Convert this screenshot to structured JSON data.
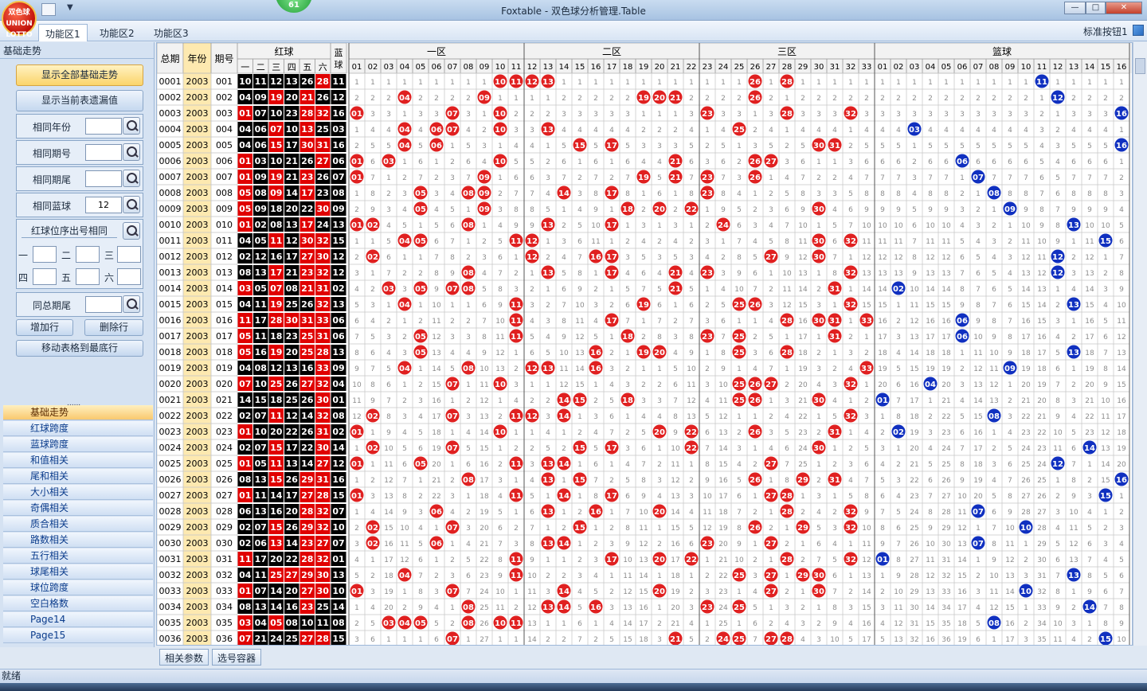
{
  "window": {
    "title": "Foxtable - 双色球分析管理.Table",
    "logo_text": "双色球 UNION LOTTO",
    "badge": "61"
  },
  "ribbon": {
    "tabs": [
      "功能区1",
      "功能区2",
      "功能区3"
    ],
    "active_tab": 0,
    "right_button": "标准按钮1"
  },
  "left_panel": {
    "title": "基础走势",
    "show_all_button": "显示全部基础走势",
    "show_missing_button": "显示当前表遗漏值",
    "same_year_label": "相同年份",
    "same_year_value": "",
    "same_period_label": "相同期号",
    "same_period_value": "",
    "same_tail_label": "相同期尾",
    "same_tail_value": "",
    "same_blue_label": "相同蓝球",
    "same_blue_value": "12",
    "position_label": "红球位序出号相同",
    "pos_labels": [
      "一",
      "二",
      "三",
      "四",
      "五",
      "六"
    ],
    "same_total_tail_label": "同总期尾",
    "same_total_tail_value": "",
    "add_row_button": "增加行",
    "delete_row_button": "删除行",
    "move_bottom_button": "移动表格到最底行",
    "splitter": "......",
    "nav_items": [
      "基础走势",
      "红球跨度",
      "蓝球跨度",
      "和值相关",
      "尾和相关",
      "大小相关",
      "奇偶相关",
      "质合相关",
      "路数相关",
      "五行相关",
      "球尾相关",
      "球位跨度",
      "空白格数",
      "Page14",
      "Page15"
    ],
    "active_nav": 0
  },
  "grid": {
    "col_total": "总期",
    "col_year": "年份",
    "col_period": "期号",
    "red_header": "红球",
    "red_positions": [
      "一",
      "二",
      "三",
      "四",
      "五",
      "六"
    ],
    "blue_header": "蓝球",
    "zone_headers": [
      "一区",
      "二区",
      "三区"
    ],
    "blue_zone_header": "篮球",
    "red_numbers": [
      "01",
      "02",
      "03",
      "04",
      "05",
      "06",
      "07",
      "08",
      "09",
      "10",
      "11",
      "12",
      "13",
      "14",
      "15",
      "16",
      "17",
      "18",
      "19",
      "20",
      "21",
      "22",
      "23",
      "24",
      "25",
      "26",
      "27",
      "28",
      "29",
      "30",
      "31",
      "32",
      "33"
    ],
    "blue_numbers": [
      "01",
      "02",
      "03",
      "04",
      "05",
      "06",
      "07",
      "08",
      "09",
      "10",
      "11",
      "12",
      "13",
      "14",
      "15",
      "16"
    ],
    "year": "2003",
    "rows": [
      {
        "red": [
          "10",
          "11",
          "12",
          "13",
          "26",
          "28"
        ],
        "blue": "11"
      },
      {
        "red": [
          "04",
          "09",
          "19",
          "20",
          "21",
          "26"
        ],
        "blue": "12"
      },
      {
        "red": [
          "01",
          "07",
          "10",
          "23",
          "28",
          "32"
        ],
        "blue": "16"
      },
      {
        "red": [
          "04",
          "06",
          "07",
          "10",
          "13",
          "25"
        ],
        "blue": "03"
      },
      {
        "red": [
          "04",
          "06",
          "15",
          "17",
          "30",
          "31"
        ],
        "blue": "16"
      },
      {
        "red": [
          "01",
          "03",
          "10",
          "21",
          "26",
          "27"
        ],
        "blue": "06"
      },
      {
        "red": [
          "01",
          "09",
          "19",
          "21",
          "23",
          "26"
        ],
        "blue": "07"
      },
      {
        "red": [
          "05",
          "08",
          "09",
          "14",
          "17",
          "23"
        ],
        "blue": "08"
      },
      {
        "red": [
          "05",
          "09",
          "18",
          "20",
          "22",
          "30"
        ],
        "blue": "09"
      },
      {
        "red": [
          "01",
          "02",
          "08",
          "13",
          "17",
          "24"
        ],
        "blue": "13"
      },
      {
        "red": [
          "04",
          "05",
          "11",
          "12",
          "30",
          "32"
        ],
        "blue": "15"
      },
      {
        "red": [
          "02",
          "12",
          "16",
          "17",
          "27",
          "30"
        ],
        "blue": "12"
      },
      {
        "red": [
          "08",
          "13",
          "17",
          "21",
          "23",
          "32"
        ],
        "blue": "12"
      },
      {
        "red": [
          "03",
          "05",
          "07",
          "08",
          "21",
          "31"
        ],
        "blue": "02"
      },
      {
        "red": [
          "04",
          "11",
          "19",
          "25",
          "26",
          "32"
        ],
        "blue": "13"
      },
      {
        "red": [
          "11",
          "17",
          "28",
          "30",
          "31",
          "33"
        ],
        "blue": "06"
      },
      {
        "red": [
          "05",
          "11",
          "18",
          "23",
          "25",
          "31"
        ],
        "blue": "06"
      },
      {
        "red": [
          "05",
          "16",
          "19",
          "20",
          "25",
          "28"
        ],
        "blue": "13"
      },
      {
        "red": [
          "04",
          "08",
          "12",
          "13",
          "16",
          "33"
        ],
        "blue": "09"
      },
      {
        "red": [
          "07",
          "10",
          "25",
          "26",
          "27",
          "32"
        ],
        "blue": "04"
      },
      {
        "red": [
          "14",
          "15",
          "18",
          "25",
          "26",
          "30"
        ],
        "blue": "01"
      },
      {
        "red": [
          "02",
          "07",
          "11",
          "12",
          "14",
          "32"
        ],
        "blue": "08"
      },
      {
        "red": [
          "01",
          "10",
          "20",
          "22",
          "26",
          "31"
        ],
        "blue": "02"
      },
      {
        "red": [
          "02",
          "07",
          "15",
          "17",
          "22",
          "30"
        ],
        "blue": "14"
      },
      {
        "red": [
          "01",
          "05",
          "11",
          "13",
          "14",
          "27"
        ],
        "blue": "12"
      },
      {
        "red": [
          "08",
          "13",
          "15",
          "26",
          "29",
          "31"
        ],
        "blue": "16"
      },
      {
        "red": [
          "01",
          "11",
          "14",
          "17",
          "27",
          "28"
        ],
        "blue": "15"
      },
      {
        "red": [
          "06",
          "13",
          "16",
          "20",
          "28",
          "32"
        ],
        "blue": "07"
      },
      {
        "red": [
          "02",
          "07",
          "15",
          "26",
          "29",
          "32"
        ],
        "blue": "10"
      },
      {
        "red": [
          "02",
          "06",
          "13",
          "14",
          "23",
          "27"
        ],
        "blue": "07"
      },
      {
        "red": [
          "11",
          "17",
          "20",
          "22",
          "28",
          "32"
        ],
        "blue": "01"
      },
      {
        "red": [
          "04",
          "11",
          "25",
          "27",
          "29",
          "30"
        ],
        "blue": "13"
      },
      {
        "red": [
          "01",
          "07",
          "14",
          "20",
          "27",
          "30"
        ],
        "blue": "10"
      },
      {
        "red": [
          "08",
          "13",
          "14",
          "16",
          "23",
          "25"
        ],
        "blue": "14"
      },
      {
        "red": [
          "03",
          "04",
          "05",
          "08",
          "10",
          "11"
        ],
        "blue": "08"
      },
      {
        "red": [
          "07",
          "21",
          "24",
          "25",
          "27",
          "28"
        ],
        "blue": "15"
      }
    ]
  },
  "bottom_tabs": [
    "相关参数",
    "选号容器"
  ],
  "status": "就绪",
  "colors": {
    "red_ball": "#e02020",
    "blue_ball": "#1030c0",
    "red_cell_black": "#000000",
    "red_cell_red": "#e00000",
    "blue_cell": "#000000",
    "grid_line": "#c8c8c8",
    "header_bg": "#f2f2f2"
  }
}
